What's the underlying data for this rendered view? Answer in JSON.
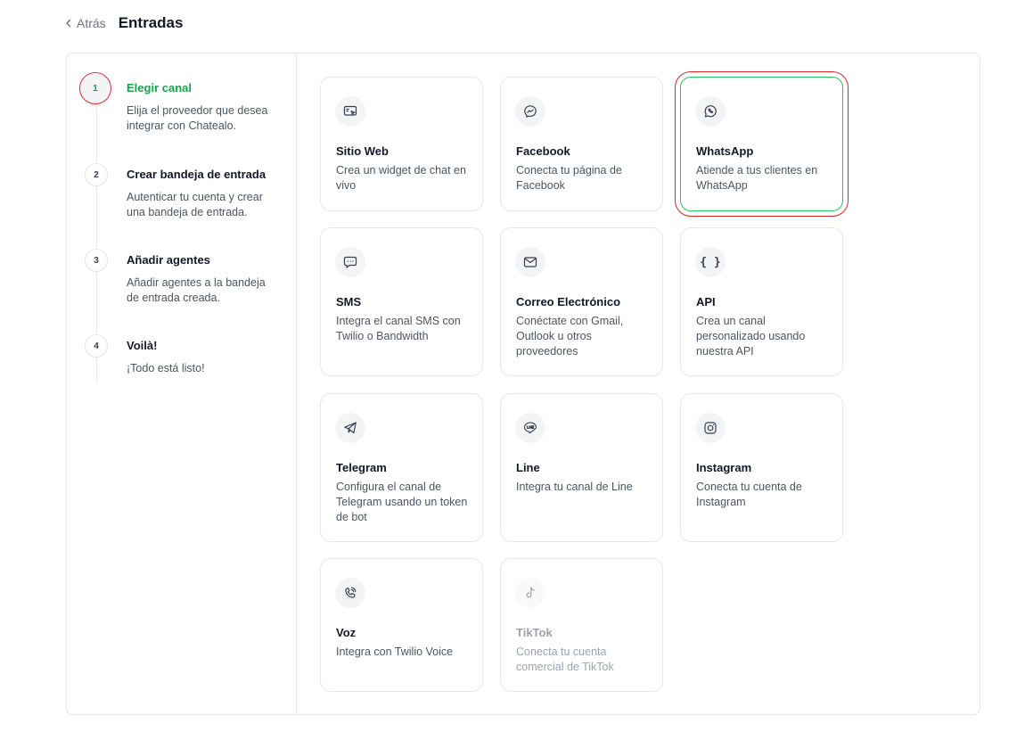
{
  "header": {
    "back_label": "Atrás",
    "title": "Entradas"
  },
  "steps": [
    {
      "number": "1",
      "title": "Elegir canal",
      "description": "Elija el proveedor que desea integrar con Chatealo.",
      "active": true
    },
    {
      "number": "2",
      "title": "Crear bandeja de entrada",
      "description": "Autenticar tu cuenta y crear una bandeja de entrada.",
      "active": false
    },
    {
      "number": "3",
      "title": "Añadir agentes",
      "description": "Añadir agentes a la bandeja de entrada creada.",
      "active": false
    },
    {
      "number": "4",
      "title": "Voilà!",
      "description": "¡Todo está listo!",
      "active": false
    }
  ],
  "channels": [
    {
      "name": "Sitio Web",
      "description": "Crea un widget de chat en vivo",
      "icon": "website-icon"
    },
    {
      "name": "Facebook",
      "description": "Conecta tu página de Facebook",
      "icon": "messenger-icon"
    },
    {
      "name": "WhatsApp",
      "description": "Atiende a tus clientes en WhatsApp",
      "icon": "whatsapp-icon",
      "selected": true
    },
    {
      "name": "SMS",
      "description": "Integra el canal SMS con Twilio o Bandwidth",
      "icon": "sms-icon"
    },
    {
      "name": "Correo Electrónico",
      "description": "Conéctate con Gmail, Outlook u otros proveedores",
      "icon": "email-icon"
    },
    {
      "name": "API",
      "description": "Crea un canal personalizado usando nuestra API",
      "icon": "api-icon"
    },
    {
      "name": "Telegram",
      "description": "Configura el canal de Telegram usando un token de bot",
      "icon": "telegram-icon"
    },
    {
      "name": "Line",
      "description": "Integra tu canal de Line",
      "icon": "line-icon"
    },
    {
      "name": "Instagram",
      "description": "Conecta tu cuenta de Instagram",
      "icon": "instagram-icon"
    },
    {
      "name": "Voz",
      "description": "Integra con Twilio Voice",
      "icon": "voice-icon"
    },
    {
      "name": "TikTok",
      "description": "Conecta tu cuenta comercial de TikTok",
      "icon": "tiktok-icon",
      "disabled": true
    }
  ],
  "colors": {
    "accent": "#16a34a",
    "selected_border": "#22c55e",
    "highlight": "#e02424"
  }
}
